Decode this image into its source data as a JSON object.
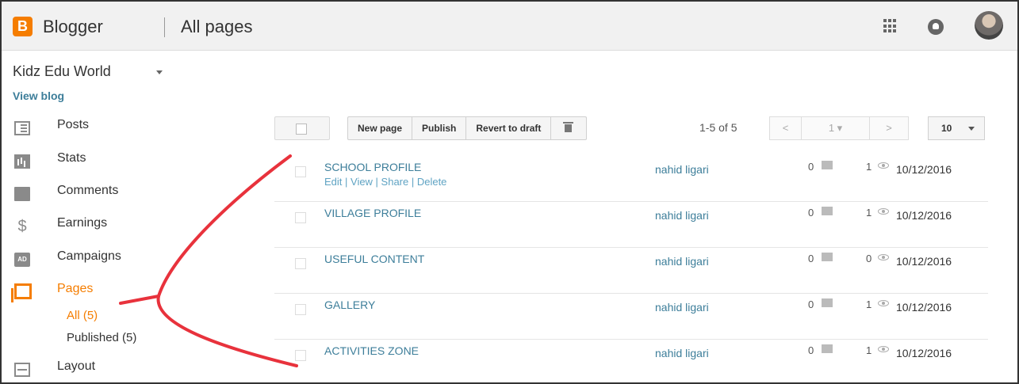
{
  "header": {
    "logo_letter": "B",
    "brand": "Blogger",
    "title": "All pages",
    "apps_icon": "apps-grid-icon",
    "notification_icon": "notifications-icon"
  },
  "sidebar": {
    "blog_name": "Kidz Edu World",
    "view_blog": "View blog",
    "items": [
      {
        "label": "Posts",
        "icon": "posts-icon"
      },
      {
        "label": "Stats",
        "icon": "stats-icon"
      },
      {
        "label": "Comments",
        "icon": "comments-icon"
      },
      {
        "label": "Earnings",
        "icon": "earnings-icon",
        "glyph": "$"
      },
      {
        "label": "Campaigns",
        "icon": "campaigns-icon",
        "glyph": "AD"
      },
      {
        "label": "Pages",
        "icon": "pages-icon"
      },
      {
        "label": "Layout",
        "icon": "layout-icon"
      }
    ],
    "pages_sub": {
      "all": "All (5)",
      "published": "Published (5)"
    }
  },
  "toolbar": {
    "new_page": "New page",
    "publish": "Publish",
    "revert": "Revert to draft",
    "count": "1-5 of 5",
    "pager": {
      "prev": "<",
      "page": "1 ▾",
      "next": ">"
    },
    "per_page": "10"
  },
  "pages": [
    {
      "title": "SCHOOL PROFILE",
      "actions": "Edit | View | Share | Delete",
      "author": "nahid ligari",
      "comments": "0",
      "views": "1",
      "date": "10/12/2016"
    },
    {
      "title": "VILLAGE PROFILE",
      "actions": "",
      "author": "nahid ligari",
      "comments": "0",
      "views": "1",
      "date": "10/12/2016"
    },
    {
      "title": "USEFUL CONTENT",
      "actions": "",
      "author": "nahid ligari",
      "comments": "0",
      "views": "0",
      "date": "10/12/2016"
    },
    {
      "title": "GALLERY",
      "actions": "",
      "author": "nahid ligari",
      "comments": "0",
      "views": "1",
      "date": "10/12/2016"
    },
    {
      "title": "ACTIVITIES ZONE",
      "actions": "",
      "author": "nahid ligari",
      "comments": "0",
      "views": "1",
      "date": "10/12/2016"
    }
  ],
  "colors": {
    "accent": "#f57d00",
    "link": "#3d7e9a",
    "annotation": "#e8323c"
  }
}
